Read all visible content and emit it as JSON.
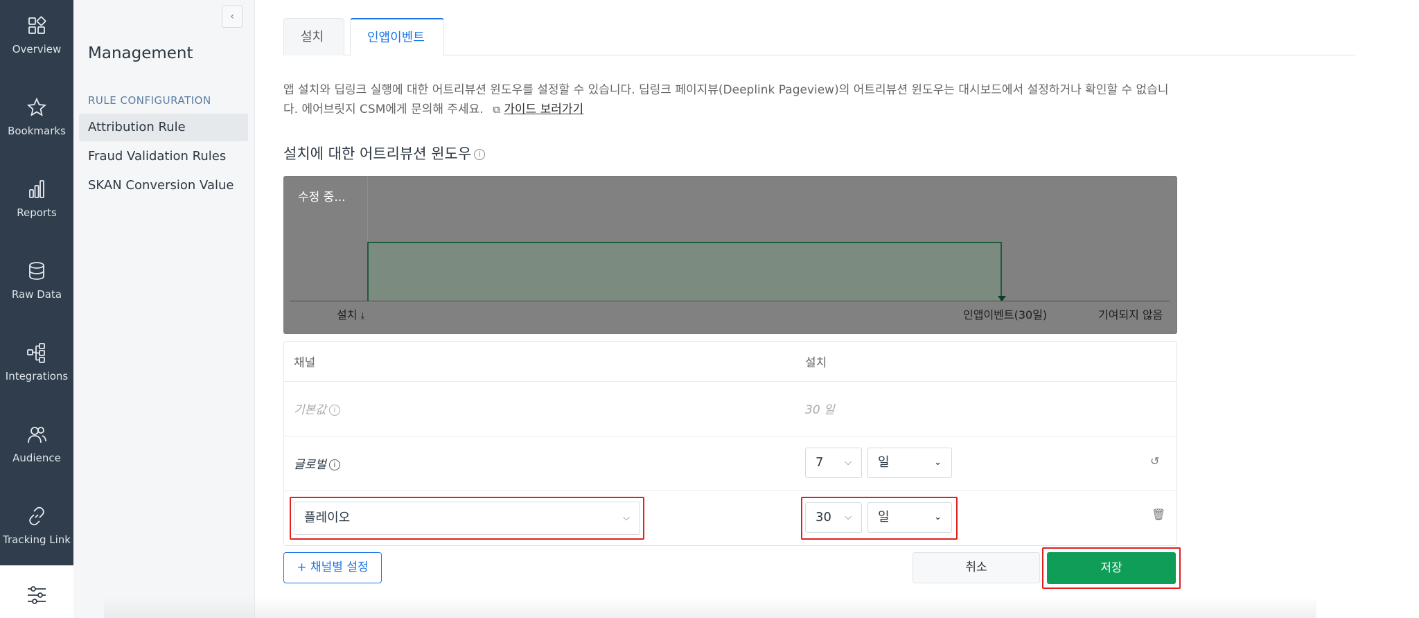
{
  "rail": {
    "items": [
      {
        "label": "Overview",
        "icon": "overview-grid-icon"
      },
      {
        "label": "Bookmarks",
        "icon": "star-icon"
      },
      {
        "label": "Reports",
        "icon": "bar-chart-icon"
      },
      {
        "label": "Raw Data",
        "icon": "database-icon"
      },
      {
        "label": "Integrations",
        "icon": "integrations-icon"
      },
      {
        "label": "Audience",
        "icon": "users-icon"
      },
      {
        "label": "Tracking Link",
        "icon": "link-icon"
      }
    ],
    "bottom_icon": "sliders-icon"
  },
  "submenu": {
    "collapse_label": "‹",
    "title": "Management",
    "section": "RULE CONFIGURATION",
    "items": [
      {
        "label": "Attribution Rule",
        "active": true
      },
      {
        "label": "Fraud Validation Rules",
        "active": false
      },
      {
        "label": "SKAN Conversion Value",
        "active": false
      }
    ]
  },
  "tabs": [
    {
      "label": "설치",
      "active": false
    },
    {
      "label": "인앱이벤트",
      "active": true
    }
  ],
  "description": {
    "text": "앱 설치와 딥링크 실행에 대한 어트리뷰션 윈도우를 설정할 수 있습니다. 딥링크 페이지뷰(Deeplink Pageview)의 어트리뷰션 윈도우는 대시보드에서 설정하거나 확인할 수 없습니다. 에어브릿지 CSM에게 문의해 주세요.",
    "guide_link": "가이드 보러가기"
  },
  "section_title": "설치에 대한 어트리뷰션 윈도우",
  "graph": {
    "editing_label": "수정 중...",
    "install_label": "설치",
    "inapp_label": "인앱이벤트(30일)",
    "not_attributed_label": "기여되지 않음",
    "colors": {
      "background": "#818181",
      "window_line": "#1f5a3a"
    }
  },
  "table": {
    "headers": {
      "channel": "채널",
      "install": "설치"
    },
    "default_row": {
      "channel": "기본값",
      "value": "30 일"
    },
    "global_row": {
      "channel": "글로벌",
      "number": "7",
      "unit": "일"
    },
    "custom_row": {
      "channel": "플레이오",
      "number": "30",
      "unit": "일"
    }
  },
  "buttons": {
    "add_channel": "+ 채널별 설정",
    "cancel": "취소",
    "save": "저장"
  },
  "colors": {
    "accent": "#1a73e8",
    "save": "#0f9d58",
    "highlight": "#e0201c",
    "rail": "#2f3d4c"
  }
}
